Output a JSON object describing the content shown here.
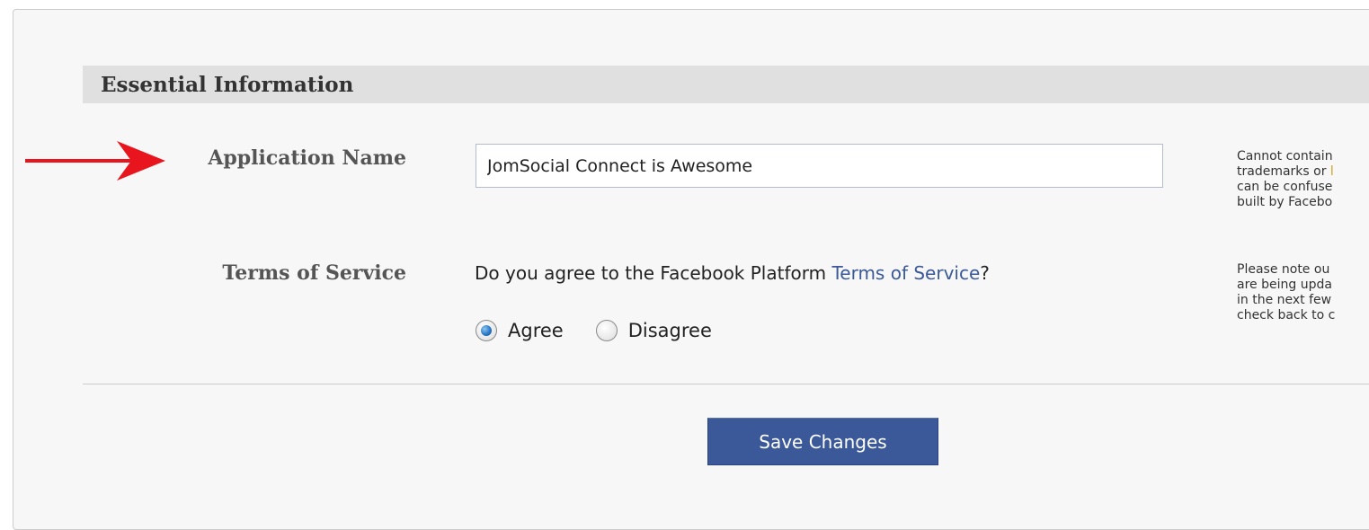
{
  "section": {
    "title": "Essential Information"
  },
  "form": {
    "app_name_label": "Application Name",
    "app_name_value": "JomSocial Connect is Awesome",
    "terms_label": "Terms of Service",
    "terms_question_prefix": "Do you agree to the Facebook Platform ",
    "terms_link": "Terms of Service",
    "terms_question_suffix": "?",
    "radio_agree_label": "Agree",
    "radio_disagree_label": "Disagree",
    "selected_option": "Agree"
  },
  "help": {
    "app_name_lines": [
      "Cannot contain",
      "trademarks or ",
      "can be confuse",
      "built by Facebo"
    ],
    "app_name_link_fragment": "l",
    "terms_lines": [
      "Please note ou",
      "are being upda",
      "in the next few",
      "check back to c"
    ]
  },
  "actions": {
    "save_label": "Save Changes"
  },
  "colors": {
    "accent": "#3b5998",
    "arrow": "#e8141e",
    "header_bg": "#e0e0e0",
    "panel_bg": "#f7f7f7"
  },
  "icons": {
    "pointer": "red-arrow-icon"
  }
}
